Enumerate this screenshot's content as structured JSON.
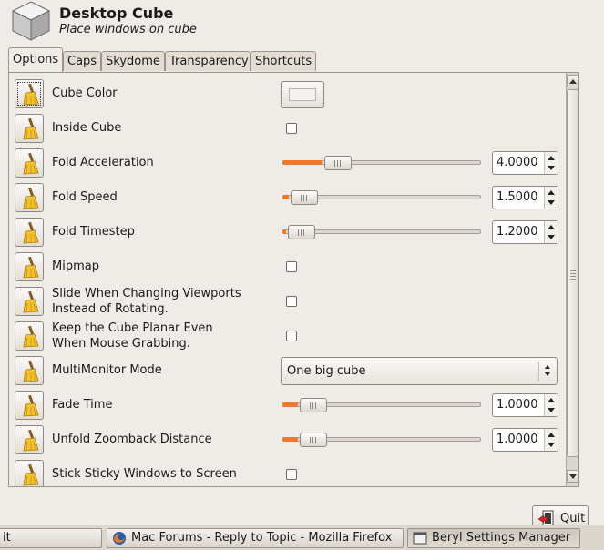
{
  "header": {
    "title": "Desktop Cube",
    "subtitle": "Place windows on cube"
  },
  "tabs": [
    {
      "label": "Options",
      "active": true
    },
    {
      "label": "Caps"
    },
    {
      "label": "Skydome"
    },
    {
      "label": "Transparency"
    },
    {
      "label": "Shortcuts"
    }
  ],
  "options": [
    {
      "label": "Cube Color",
      "control": "color",
      "color": "#f4f2f0"
    },
    {
      "label": "Inside Cube",
      "control": "checkbox",
      "checked": false
    },
    {
      "label": "Fold Acceleration",
      "control": "slider",
      "value": "4.0000",
      "fill_fraction": 0.2
    },
    {
      "label": "Fold Speed",
      "control": "slider",
      "value": "1.5000",
      "fill_fraction": 0.03
    },
    {
      "label": "Fold Timestep",
      "control": "slider",
      "value": "1.2000",
      "fill_fraction": 0.02
    },
    {
      "label": "Mipmap",
      "control": "checkbox",
      "checked": false
    },
    {
      "label": "Slide When Changing Viewports Instead of Rotating.",
      "line1": "Slide When Changing Viewports",
      "line2": "Instead of Rotating.",
      "control": "checkbox",
      "checked": false
    },
    {
      "label": "Keep the Cube Planar Even When Mouse Grabbing.",
      "line1": "Keep the Cube Planar Even",
      "line2": "When Mouse Grabbing.",
      "control": "checkbox",
      "checked": false
    },
    {
      "label": "MultiMonitor Mode",
      "control": "combo",
      "value": "One big cube"
    },
    {
      "label": "Fade Time",
      "control": "slider",
      "value": "1.0000",
      "fill_fraction": 0.08
    },
    {
      "label": "Unfold Zoomback Distance",
      "control": "slider",
      "value": "1.0000",
      "fill_fraction": 0.08
    },
    {
      "label": "Stick Sticky Windows to Screen",
      "control": "checkbox",
      "checked": false
    }
  ],
  "buttons": {
    "quit_label": "Quit"
  },
  "taskbar": {
    "items": [
      {
        "label": "it"
      },
      {
        "label": "Mac Forums - Reply to Topic - Mozilla Firefox",
        "icon": "firefox-icon"
      },
      {
        "label": "Beryl Settings Manager",
        "icon": "window-icon",
        "pressed": true
      }
    ]
  },
  "colors": {
    "accent": "#f07a2a",
    "background": "#efebe7"
  }
}
